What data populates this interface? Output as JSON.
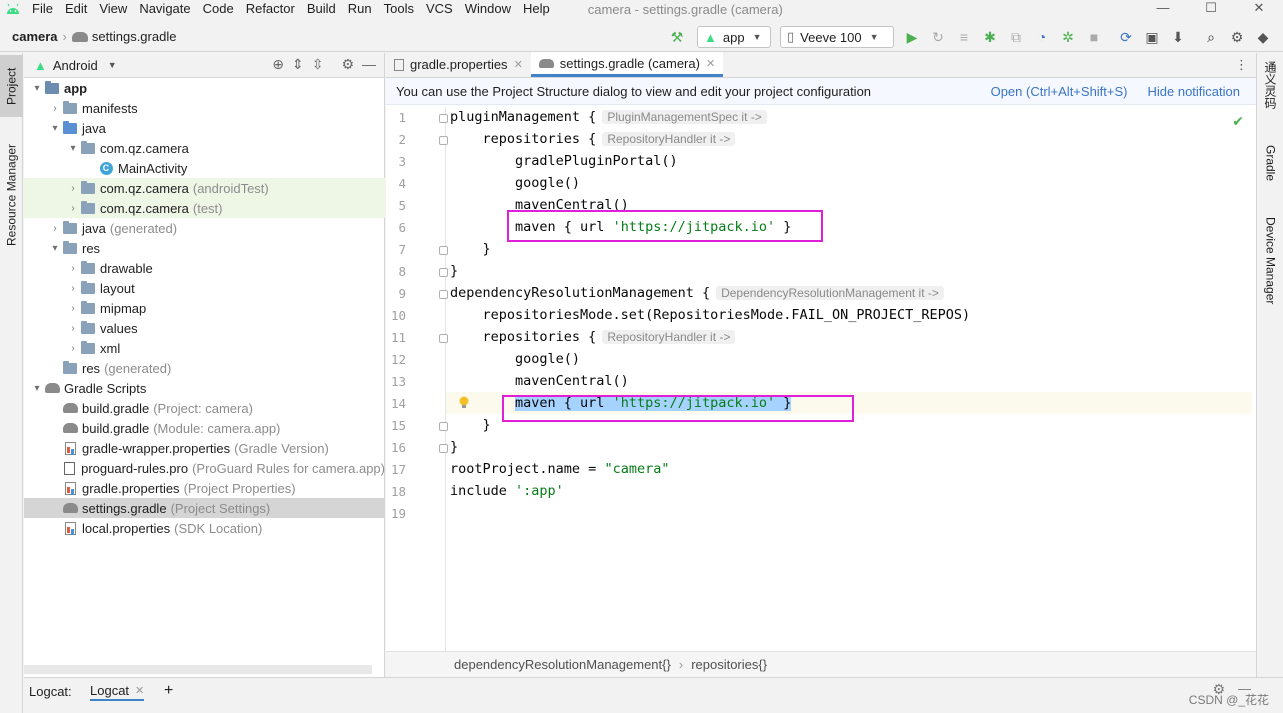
{
  "menubar": {
    "items": [
      "File",
      "Edit",
      "View",
      "Navigate",
      "Code",
      "Refactor",
      "Build",
      "Run",
      "Tools",
      "VCS",
      "Window",
      "Help"
    ],
    "window_title": "camera - settings.gradle (camera)",
    "win_controls": [
      "—",
      "☐",
      "✕"
    ]
  },
  "navbar": {
    "project": "camera",
    "file": "settings.gradle",
    "run_config": "app",
    "device": "Veeve 100"
  },
  "left_strip": {
    "project_tab": "Project",
    "resource_tab": "Resource Manager"
  },
  "right_strip": {
    "tab1": "通义灵码",
    "tab2": "Gradle",
    "tab3": "Device Manager"
  },
  "project_panel": {
    "view_mode": "Android",
    "rows": [
      {
        "label": "app",
        "hint": "",
        "indent": 0,
        "chev": "▾",
        "icon": "module-folder-icon",
        "bold": true
      },
      {
        "label": "manifests",
        "hint": "",
        "indent": 1,
        "chev": "›",
        "icon": "folder-icon"
      },
      {
        "label": "java",
        "hint": "",
        "indent": 1,
        "chev": "▾",
        "icon": "source-folder-icon"
      },
      {
        "label": "com.qz.camera",
        "hint": "",
        "indent": 2,
        "chev": "▾",
        "icon": "package-icon"
      },
      {
        "label": "MainActivity",
        "hint": "",
        "indent": 3,
        "chev": "",
        "icon": "class-icon"
      },
      {
        "label": "com.qz.camera",
        "hint": "(androidTest)",
        "indent": 2,
        "chev": "›",
        "icon": "package-icon",
        "green": true
      },
      {
        "label": "com.qz.camera",
        "hint": "(test)",
        "indent": 2,
        "chev": "›",
        "icon": "package-icon",
        "green": true
      },
      {
        "label": "java",
        "hint": "(generated)",
        "indent": 1,
        "chev": "›",
        "icon": "generated-folder-icon"
      },
      {
        "label": "res",
        "hint": "",
        "indent": 1,
        "chev": "▾",
        "icon": "res-folder-icon"
      },
      {
        "label": "drawable",
        "hint": "",
        "indent": 2,
        "chev": "›",
        "icon": "folder-icon"
      },
      {
        "label": "layout",
        "hint": "",
        "indent": 2,
        "chev": "›",
        "icon": "folder-icon"
      },
      {
        "label": "mipmap",
        "hint": "",
        "indent": 2,
        "chev": "›",
        "icon": "folder-icon"
      },
      {
        "label": "values",
        "hint": "",
        "indent": 2,
        "chev": "›",
        "icon": "folder-icon"
      },
      {
        "label": "xml",
        "hint": "",
        "indent": 2,
        "chev": "›",
        "icon": "folder-icon"
      },
      {
        "label": "res",
        "hint": "(generated)",
        "indent": 1,
        "chev": "",
        "icon": "res-folder-icon"
      },
      {
        "label": "Gradle Scripts",
        "hint": "",
        "indent": 0,
        "chev": "▾",
        "icon": "gradle-icon"
      },
      {
        "label": "build.gradle",
        "hint": "(Project: camera)",
        "indent": 1,
        "chev": "",
        "icon": "gradle-icon"
      },
      {
        "label": "build.gradle",
        "hint": "(Module: camera.app)",
        "indent": 1,
        "chev": "",
        "icon": "gradle-icon"
      },
      {
        "label": "gradle-wrapper.properties",
        "hint": "(Gradle Version)",
        "indent": 1,
        "chev": "",
        "icon": "properties-file-icon"
      },
      {
        "label": "proguard-rules.pro",
        "hint": "(ProGuard Rules for camera.app)",
        "indent": 1,
        "chev": "",
        "icon": "text-file-icon"
      },
      {
        "label": "gradle.properties",
        "hint": "(Project Properties)",
        "indent": 1,
        "chev": "",
        "icon": "properties-file-icon"
      },
      {
        "label": "settings.gradle",
        "hint": "(Project Settings)",
        "indent": 1,
        "chev": "",
        "icon": "gradle-icon",
        "selected": true
      },
      {
        "label": "local.properties",
        "hint": "(SDK Location)",
        "indent": 1,
        "chev": "",
        "icon": "properties-file-icon"
      }
    ]
  },
  "editor": {
    "tabs": [
      {
        "label": "gradle.properties",
        "active": false
      },
      {
        "label": "settings.gradle (camera)",
        "active": true
      }
    ],
    "notice": "You can use the Project Structure dialog to view and edit your project configuration",
    "notice_links": [
      "Open (Ctrl+Alt+Shift+S)",
      "Hide notification"
    ],
    "line_numbers": [
      "1",
      "2",
      "3",
      "4",
      "5",
      "6",
      "7",
      "8",
      "9",
      "10",
      "11",
      "12",
      "13",
      "14",
      "15",
      "16",
      "17",
      "18",
      "19"
    ],
    "code": {
      "l1": "pluginManagement {",
      "l1_hint": "PluginManagementSpec it ->",
      "l2": "    repositories {",
      "l2_hint": "RepositoryHandler it ->",
      "l3": "        gradlePluginPortal()",
      "l4": "        google()",
      "l5": "        mavenCentral()",
      "l6_pre": "        maven { url ",
      "l6_str": "'https://jitpack.io'",
      "l6_post": " }",
      "l7": "    }",
      "l8": "}",
      "l9": "dependencyResolutionManagement {",
      "l9_hint": "DependencyResolutionManagement it ->",
      "l10": "    repositoriesMode.set(RepositoriesMode.FAIL_ON_PROJECT_REPOS)",
      "l11": "    repositories {",
      "l11_hint": "RepositoryHandler it ->",
      "l12": "        google()",
      "l13": "        mavenCentral()",
      "l14_pre": "maven { url ",
      "l14_str": "'https://jitpack.io'",
      "l14_post": " }",
      "l15": "    }",
      "l16": "}",
      "l17_pre": "rootProject.name = ",
      "l17_str": "\"camera\"",
      "l18_pre": "include ",
      "l18_str": "':app'"
    },
    "breadcrumb": [
      "dependencyResolutionManagement{}",
      "repositories{}"
    ]
  },
  "bottom": {
    "logcat_label": "Logcat:",
    "logcat_tab": "Logcat",
    "add": "+",
    "watermark": "CSDN @_花花"
  },
  "colors": {
    "accent": "#4083c9",
    "highlight_box": "#e020d8",
    "string": "#067d17",
    "selection": "#a6d2ff"
  }
}
